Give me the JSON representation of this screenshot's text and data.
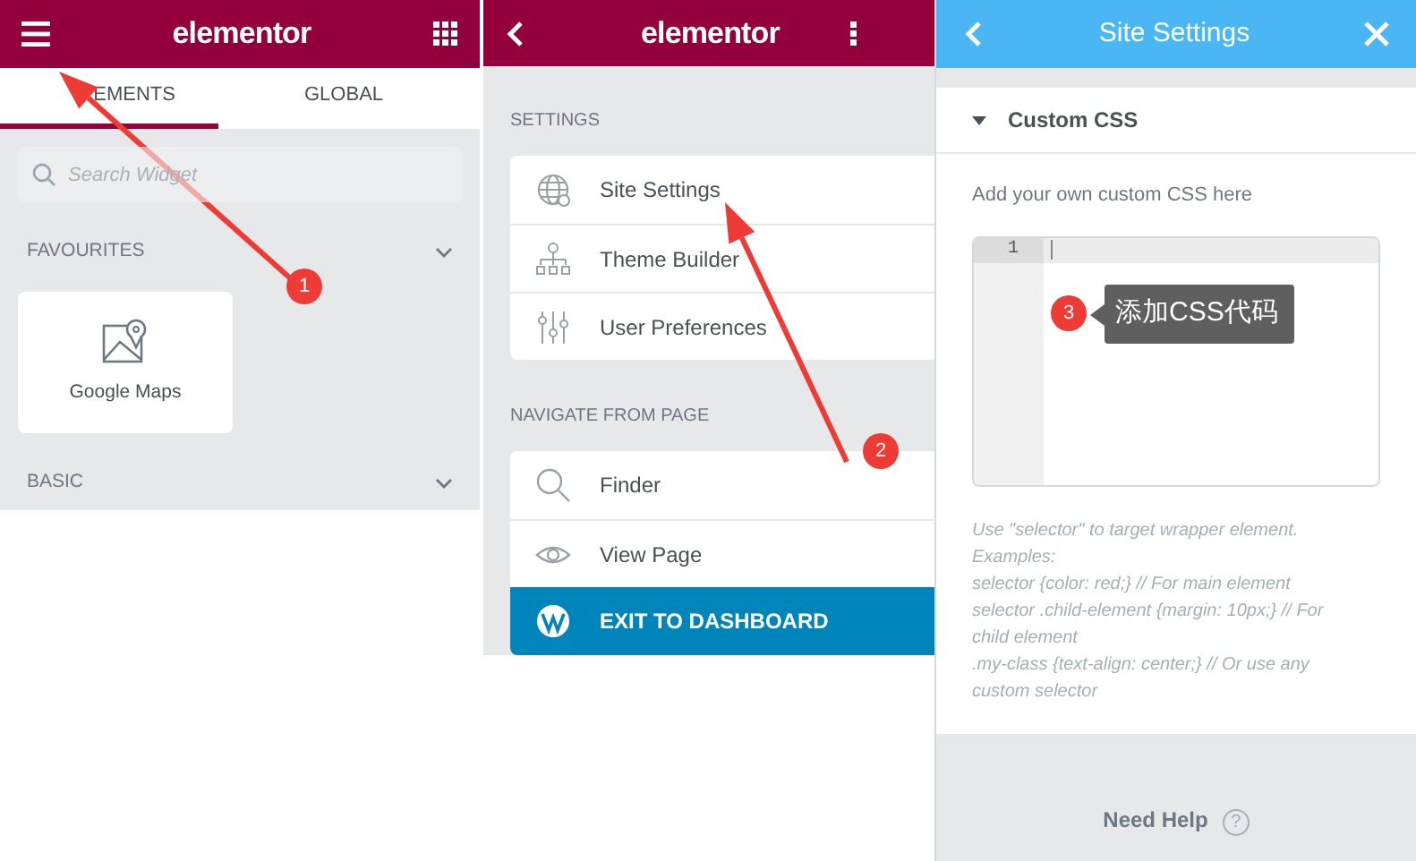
{
  "elements_panel": {
    "logo": "elementor",
    "tabs": [
      {
        "label": "EMENTS",
        "selected": true
      },
      {
        "label": "GLOBAL",
        "selected": false
      }
    ],
    "search": {
      "placeholder": "Search Widget"
    },
    "categories": [
      {
        "title": "FAVOURITES",
        "widgets": [
          {
            "label": "Google Maps"
          }
        ]
      },
      {
        "title": "BASIC"
      }
    ]
  },
  "menu_panel": {
    "logo": "elementor",
    "sections": [
      {
        "title": "SETTINGS",
        "items": [
          {
            "label": "Site Settings",
            "kind": "globe"
          },
          {
            "label": "Theme Builder",
            "kind": "sitemap"
          },
          {
            "label": "User Preferences",
            "kind": "sliders"
          }
        ]
      },
      {
        "title": "NAVIGATE FROM PAGE",
        "items": [
          {
            "label": "Finder",
            "kind": "search"
          },
          {
            "label": "View Page",
            "kind": "eye"
          },
          {
            "label": "EXIT TO DASHBOARD",
            "kind": "wordpress"
          }
        ]
      }
    ]
  },
  "site_settings_panel": {
    "title": "Site Settings",
    "section": {
      "title": "Custom CSS",
      "expanded": true
    },
    "description": "Add your own custom CSS here",
    "editor": {
      "line_numbers": [
        "1"
      ]
    },
    "help_lines": [
      "Use \"selector\" to target wrapper element.",
      "Examples:",
      "selector {color: red;} // For main element",
      "selector .child-element {margin: 10px;} // For",
      "child element",
      ".my-class {text-align: center;} // Or use any",
      "custom selector"
    ],
    "footer": {
      "label": "Need Help",
      "icon_text": "?"
    }
  },
  "annotations": [
    {
      "number": "1"
    },
    {
      "number": "2"
    },
    {
      "number": "3",
      "callout": "添加CSS代码"
    }
  ]
}
